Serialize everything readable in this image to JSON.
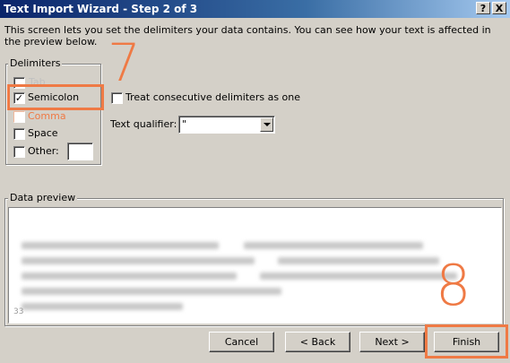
{
  "window": {
    "title": "Text Import Wizard - Step 2 of 3",
    "help_button": "?",
    "close_button": "X"
  },
  "description": "This screen lets you set the delimiters your data contains.  You can see how your text is affected in the preview below.",
  "delimiters": {
    "group_label": "Delimiters",
    "tab": {
      "label": "Tab",
      "checked": false
    },
    "semicolon": {
      "label": "Semicolon",
      "checked": true
    },
    "comma": {
      "label": "Comma",
      "checked": false
    },
    "space": {
      "label": "Space",
      "checked": false
    },
    "other": {
      "label": "Other:",
      "checked": false,
      "value": ""
    }
  },
  "consecutive": {
    "label": "Treat consecutive delimiters as one",
    "checked": false
  },
  "qualifier": {
    "label": "Text qualifier:",
    "value": "\""
  },
  "preview": {
    "group_label": "Data preview",
    "corner_number": "33"
  },
  "annotations": {
    "step7": "7",
    "step8": "8",
    "color": "#ef7a45"
  },
  "buttons": {
    "cancel": "Cancel",
    "back": "< Back",
    "next": "Next >",
    "finish": "Finish"
  },
  "check_mark": "✓"
}
